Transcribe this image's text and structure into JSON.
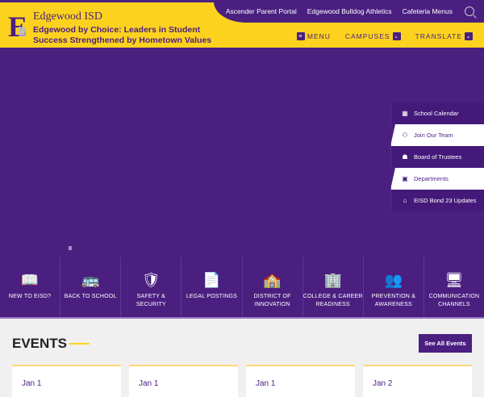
{
  "header": {
    "site_name": "Edgewood ISD",
    "tagline": "Edgewood by Choice: Leaders in Student Success Strengthened by Hometown Values",
    "logo_letter": "E"
  },
  "topbar": {
    "links": [
      "Ascender Parent Portal",
      "Edgewood Bulldog Athletics",
      "Cafeteria Menus"
    ]
  },
  "mainnav": {
    "menu": "MENU",
    "campuses": "CAMPUSES",
    "translate": "TRANSLATE"
  },
  "side_links": [
    {
      "label": "School Calendar",
      "icon": "calendar-icon",
      "glyph": "▦"
    },
    {
      "label": "Join Our Team",
      "icon": "team-icon",
      "glyph": "⚇"
    },
    {
      "label": "Board of Trustees",
      "icon": "board-icon",
      "glyph": "☗"
    },
    {
      "label": "Departments",
      "icon": "presentation-icon",
      "glyph": "▣"
    },
    {
      "label": "EISD Bond 23 Updates",
      "icon": "building-icon",
      "glyph": "⌂"
    }
  ],
  "quick_links": [
    {
      "label": "NEW TO EISD?",
      "glyph": "📖"
    },
    {
      "label": "BACK TO SCHOOL",
      "glyph": "🚌"
    },
    {
      "label": "SAFETY & SECURITY",
      "glyph": "🛡"
    },
    {
      "label": "LEGAL POSTINGS",
      "glyph": "📄"
    },
    {
      "label": "DISTRICT OF INNOVATION",
      "glyph": "🏫"
    },
    {
      "label": "COLLEGE & CAREER READINESS",
      "glyph": "🏢"
    },
    {
      "label": "PREVENTION & AWARENESS",
      "glyph": "👥"
    },
    {
      "label": "COMMUNICATION CHANNELS",
      "glyph": "🖥"
    }
  ],
  "pause": "II",
  "events": {
    "title": "EVENTS",
    "see_all": "See All Events",
    "cards": [
      "Jan 1",
      "Jan 1",
      "Jan 1",
      "Jan 2"
    ]
  }
}
